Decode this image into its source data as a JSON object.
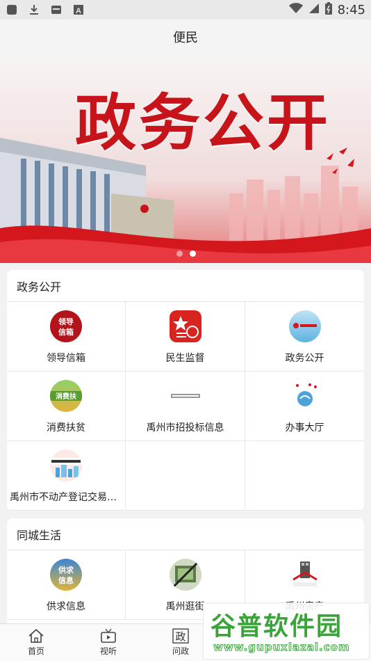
{
  "status_bar": {
    "time": "8:45"
  },
  "header": {
    "title": "便民"
  },
  "banner": {
    "title": "政务公开",
    "slide_count": 2,
    "active_slide": 2
  },
  "section_gov": {
    "title": "政务公开",
    "items": [
      {
        "label": "领导信箱",
        "icon": "leader-mailbox-icon"
      },
      {
        "label": "民生监督",
        "icon": "livelihood-supervision-icon"
      },
      {
        "label": "政务公开",
        "icon": "gov-affairs-icon"
      },
      {
        "label": "消费扶贫",
        "icon": "consumer-poverty-aid-icon"
      },
      {
        "label": "禹州市招投标信息",
        "icon": "bidding-info-icon"
      },
      {
        "label": "办事大厅",
        "icon": "service-hall-icon"
      },
      {
        "label": "禹州市不动产登记交易网…",
        "icon": "real-estate-registry-icon"
      }
    ]
  },
  "section_life": {
    "title": "同城生活",
    "items": [
      {
        "label": "供求信息",
        "icon": "supply-demand-icon"
      },
      {
        "label": "禹州逛街",
        "icon": "shopping-street-icon"
      },
      {
        "label": "禹州房产",
        "icon": "house-property-icon"
      }
    ]
  },
  "bottom_nav": [
    {
      "label": "首页",
      "icon": "home-icon"
    },
    {
      "label": "视听",
      "icon": "tv-icon"
    },
    {
      "label": "问政",
      "icon": "gov-question-icon"
    }
  ],
  "watermark": {
    "title": "谷普软件园",
    "url": "www.gupuxlazal.com"
  },
  "colors": {
    "accent_red": "#c6141a",
    "watermark_green": "#3aa43a"
  }
}
